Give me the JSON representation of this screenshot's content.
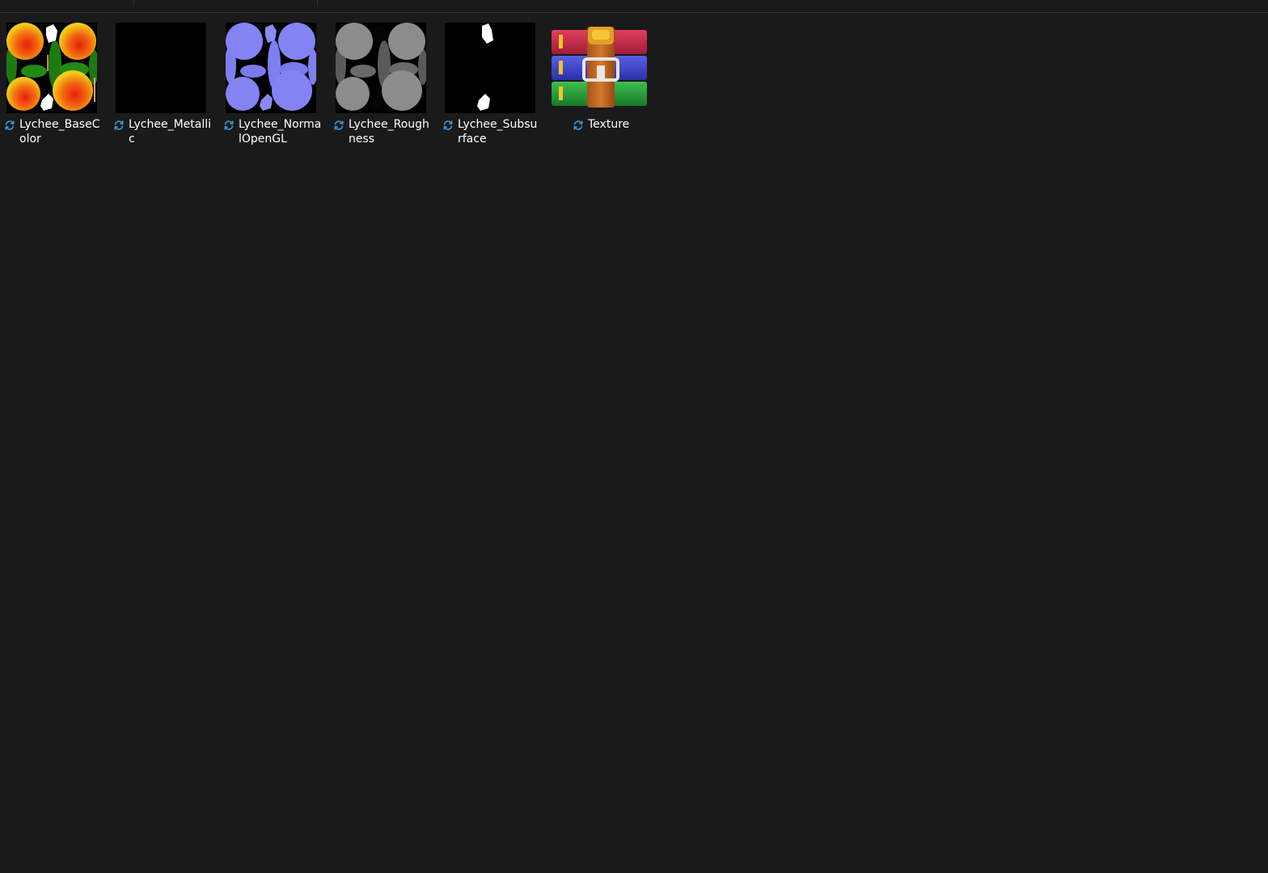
{
  "files": [
    {
      "name": "Lychee_BaseColor",
      "type": "image",
      "status_icon": "sync-pending-icon"
    },
    {
      "name": "Lychee_Metallic",
      "type": "image",
      "status_icon": "sync-pending-icon"
    },
    {
      "name": "Lychee_NormalOpenGL",
      "type": "image",
      "status_icon": "sync-pending-icon"
    },
    {
      "name": "Lychee_Roughness",
      "type": "image",
      "status_icon": "sync-pending-icon"
    },
    {
      "name": "Lychee_Subsurface",
      "type": "image",
      "status_icon": "sync-pending-icon"
    },
    {
      "name": "Texture",
      "type": "archive",
      "status_icon": "sync-pending-icon"
    }
  ],
  "colors": {
    "background": "#1a1a1a",
    "sync_icon": "#3a9be0",
    "text": "#ffffff"
  }
}
